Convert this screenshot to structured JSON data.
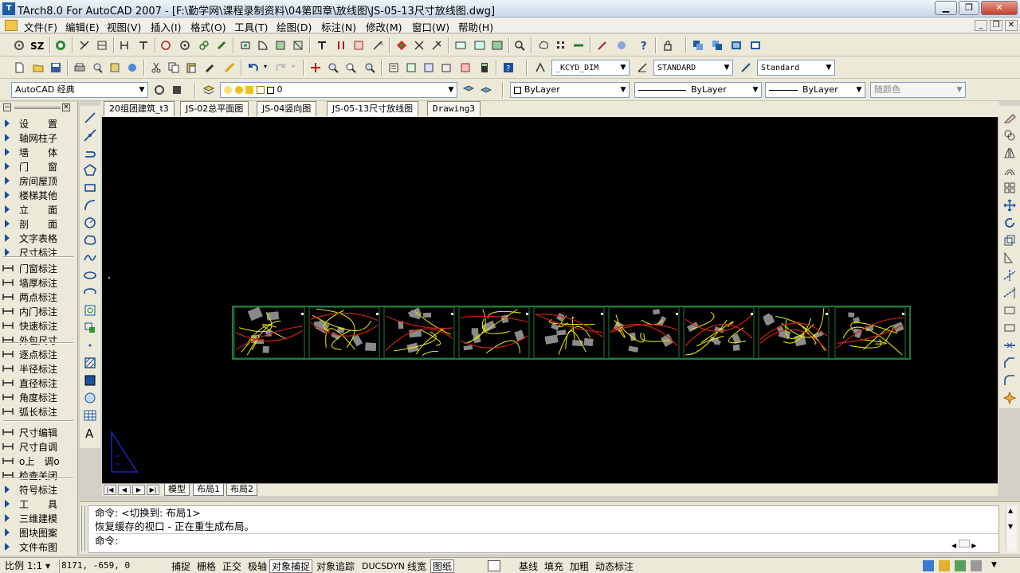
{
  "window": {
    "title": "TArch8.0 For AutoCAD 2007 - [F:\\勤学网\\课程录制资料\\04第四章\\放线图\\JS-05-13尺寸放线图.dwg]"
  },
  "menu": [
    "文件(F)",
    "编辑(E)",
    "视图(V)",
    "插入(I)",
    "格式(O)",
    "工具(T)",
    "绘图(D)",
    "标注(N)",
    "修改(M)",
    "窗口(W)",
    "帮助(H)"
  ],
  "toolbar1": {
    "sz_label": "SZ"
  },
  "toolbar2": {
    "dimstyle": "_KCYD_DIM",
    "textstyle": "STANDARD",
    "tablestyle": "Standard"
  },
  "toolbar3": {
    "workspace": "AutoCAD 经典",
    "layer": "0",
    "color": "ByLayer",
    "linetype": "ByLayer",
    "lineweight": "ByLayer",
    "plotstyle": "随颜色"
  },
  "doc_tabs": [
    "20组团建筑_t3",
    "JS-02总平面图",
    "JS-04竖向图",
    "JS-05-13尺寸放线图",
    "Drawing3"
  ],
  "active_doc_tab": "JS-05-13尺寸放线图",
  "left_panel": {
    "group1": [
      "设　　置",
      "轴网柱子",
      "墙　　体",
      "门　　窗",
      "房间屋顶",
      "楼梯其他",
      "立　　面",
      "剖　　面",
      "文字表格",
      "尺寸标注"
    ],
    "group2": [
      "门窗标注",
      "墙厚标注",
      "两点标注",
      "内门标注",
      "快速标注",
      "外包尺寸"
    ],
    "group3": [
      "逐点标注",
      "半径标注",
      "直径标注",
      "角度标注",
      "弧长标注"
    ],
    "group4": [
      "尺寸编辑",
      "尺寸自调",
      "o上　调o",
      "检查关闭"
    ],
    "group5": [
      "符号标注",
      "工　　具",
      "三维建模",
      "图块图案",
      "文件布图"
    ]
  },
  "layout_tabs": [
    "模型",
    "布局1",
    "布局2"
  ],
  "active_layout": "布局1",
  "command": {
    "line1": "命令:  <切换到: 布局1>",
    "line2": "恢复缓存的视口 - 正在重生成布局。",
    "prompt": "命令:"
  },
  "status": {
    "scale": "比例 1:1 ▾",
    "coords": "8171, -659, 0",
    "toggles": [
      "捕捉",
      "栅格",
      "正交",
      "极轴",
      "对象捕捉",
      "对象追踪",
      "DUCS",
      "DYN",
      "线宽",
      "图纸"
    ],
    "toggles_on": [
      "对象捕捉",
      "图纸"
    ],
    "right": [
      "基线",
      "填充",
      "加粗",
      "动态标注"
    ]
  },
  "colors": {
    "canvas": "#000000",
    "panel": "#ece9d8",
    "viewport_border": "#1f7a3a",
    "drawing_yellow": "#f0f000",
    "drawing_red": "#d02010",
    "drawing_gray": "#8a8a8a"
  }
}
